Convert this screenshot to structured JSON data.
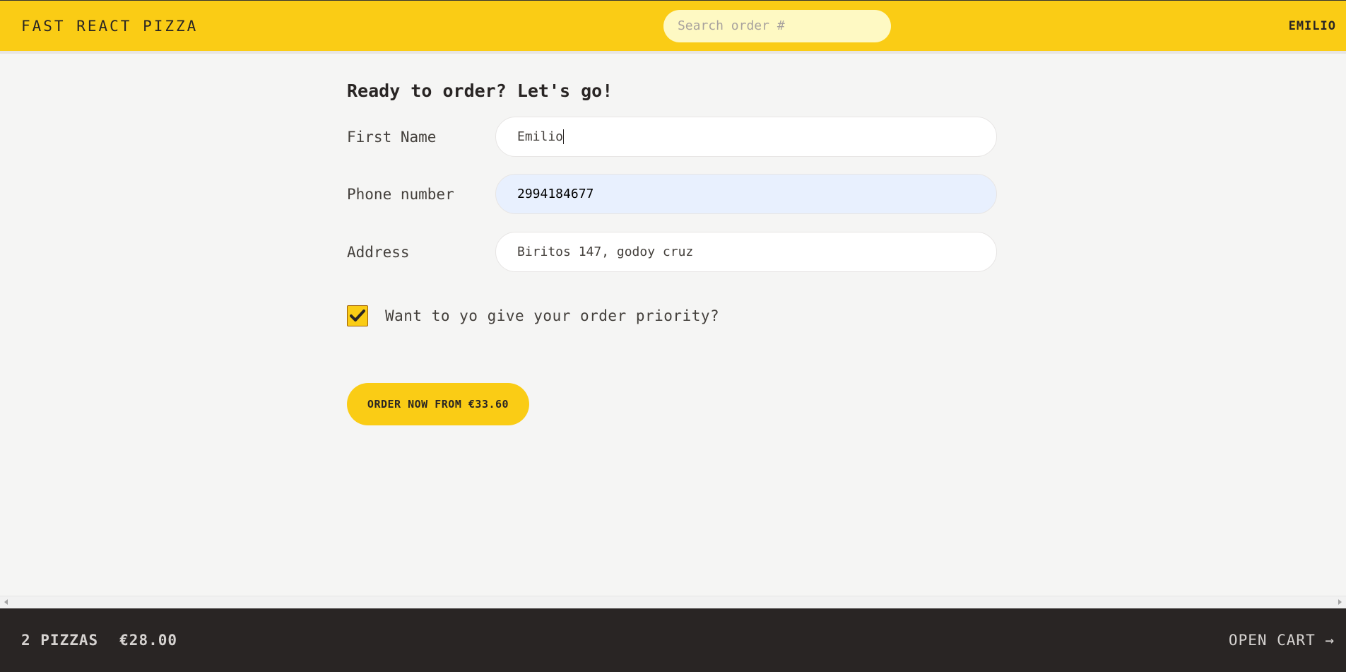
{
  "header": {
    "logo": "FAST REACT PIZZA",
    "search_placeholder": "Search order #",
    "username": "EMILIO"
  },
  "form": {
    "title": "Ready to order? Let's go!",
    "first_name": {
      "label": "First Name",
      "value": "Emilio"
    },
    "phone": {
      "label": "Phone number",
      "value": "2994184677"
    },
    "address": {
      "label": "Address",
      "value": "Biritos 147, godoy cruz"
    },
    "priority": {
      "label": "Want to yo give your order priority?",
      "checked": true
    },
    "submit_label": "ORDER NOW FROM €33.60"
  },
  "footer": {
    "pizza_count": "2 PIZZAS",
    "total": "€28.00",
    "open_cart": "OPEN CART →"
  },
  "colors": {
    "primary": "#facc15",
    "footer_bg": "#292524",
    "page_bg": "#f5f5f4",
    "autofill_bg": "#e8f0fe"
  }
}
